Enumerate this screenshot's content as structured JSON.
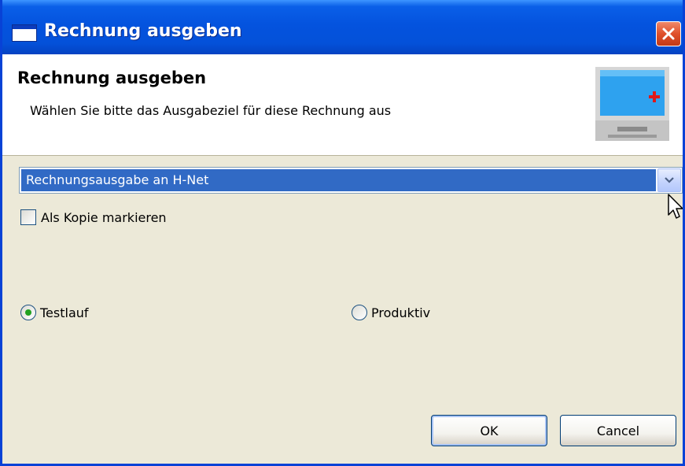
{
  "window": {
    "title": "Rechnung ausgeben"
  },
  "header": {
    "title": "Rechnung ausgeben",
    "description": "Wählen Sie bitte das Ausgabeziel für diese Rechnung aus",
    "icon": "monitor-plus-icon"
  },
  "output_target": {
    "selected": "Rechnungsausgabe an H-Net"
  },
  "copy_checkbox": {
    "label": "Als Kopie markieren",
    "checked": false
  },
  "mode": {
    "options": [
      {
        "label": "Testlauf",
        "selected": true
      },
      {
        "label": "Produktiv",
        "selected": false
      }
    ]
  },
  "buttons": {
    "ok_label": "OK",
    "cancel_label": "Cancel"
  },
  "colors": {
    "titlebar": "#0453de",
    "selection": "#316ac5",
    "dialog_background": "#ece9d8",
    "radio_selected": "#21a121"
  }
}
